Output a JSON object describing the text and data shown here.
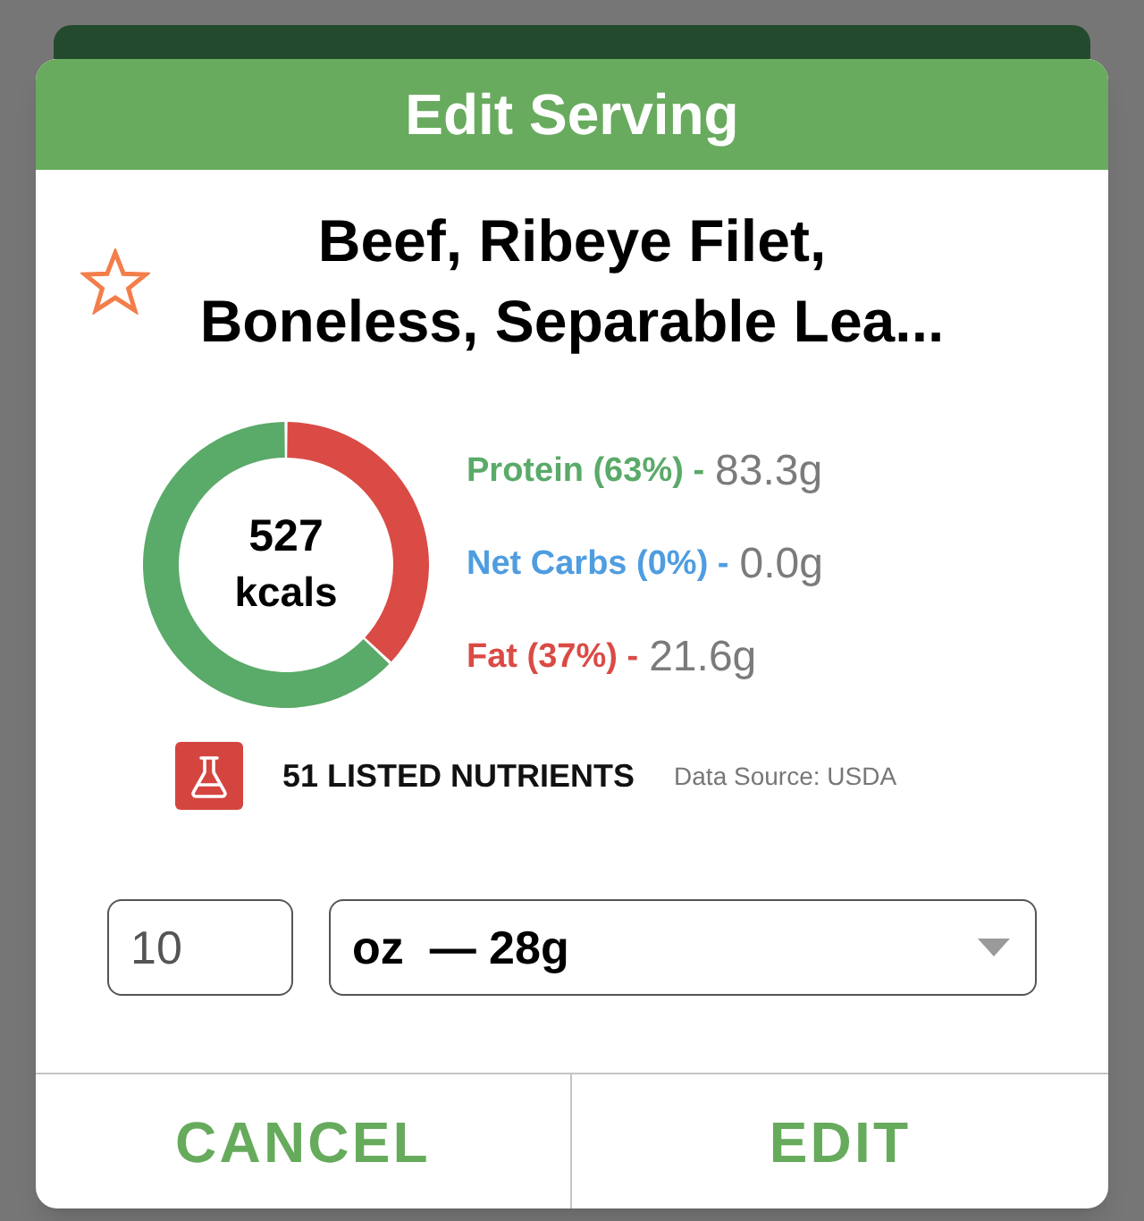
{
  "dialog": {
    "title": "Edit Serving"
  },
  "food": {
    "name": "Beef, Ribeye Filet, Boneless, Separable Lea...",
    "favorite": false
  },
  "nutrition": {
    "calories": "527",
    "calories_unit": "kcals",
    "chart_data": {
      "type": "donut",
      "values": [
        63,
        0,
        37
      ]
    },
    "macros": [
      {
        "label": "Protein (63%) -",
        "value": "83.3g",
        "color": "#5aaa69"
      },
      {
        "label": "Net Carbs (0%) -",
        "value": "0.0g",
        "color": "#4f9de0"
      },
      {
        "label": "Fat (37%) -",
        "value": "21.6g",
        "color": "#da4b45"
      }
    ]
  },
  "nutrients": {
    "count": "51 LISTED NUTRIENTS",
    "source": "Data Source: USDA"
  },
  "serving": {
    "quantity": "10",
    "unit": "oz  — 28g"
  },
  "buttons": [
    {
      "label": "CANCEL"
    },
    {
      "label": "EDIT"
    }
  ]
}
